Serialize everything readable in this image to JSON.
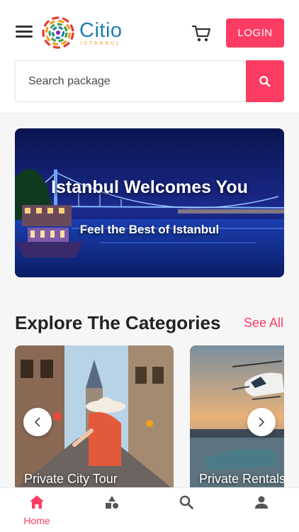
{
  "brand": {
    "name": "Citio",
    "tagline": "ISTANBUL"
  },
  "header": {
    "login_label": "LOGIN",
    "menu_icon": "hamburger-menu-icon",
    "cart_icon": "shopping-cart-icon"
  },
  "search": {
    "placeholder": "Search package",
    "value": "",
    "icon": "search-icon"
  },
  "banner": {
    "title": "Istanbul Welcomes You",
    "subtitle": "Feel the Best of Istanbul"
  },
  "categories": {
    "heading": "Explore The Categories",
    "see_all_label": "See All",
    "items": [
      {
        "label": "Private City Tour"
      },
      {
        "label": "Private Rentals"
      }
    ]
  },
  "tabbar": {
    "items": [
      {
        "label": "Home",
        "icon": "home-icon",
        "active": true
      },
      {
        "label": "",
        "icon": "categories-icon",
        "active": false
      },
      {
        "label": "",
        "icon": "search-icon",
        "active": false
      },
      {
        "label": "",
        "icon": "profile-icon",
        "active": false
      }
    ]
  },
  "colors": {
    "accent": "#fc3c63",
    "brand_blue": "#1d7fb0",
    "brand_orange": "#f2a01e",
    "inactive_icon": "#555555"
  }
}
